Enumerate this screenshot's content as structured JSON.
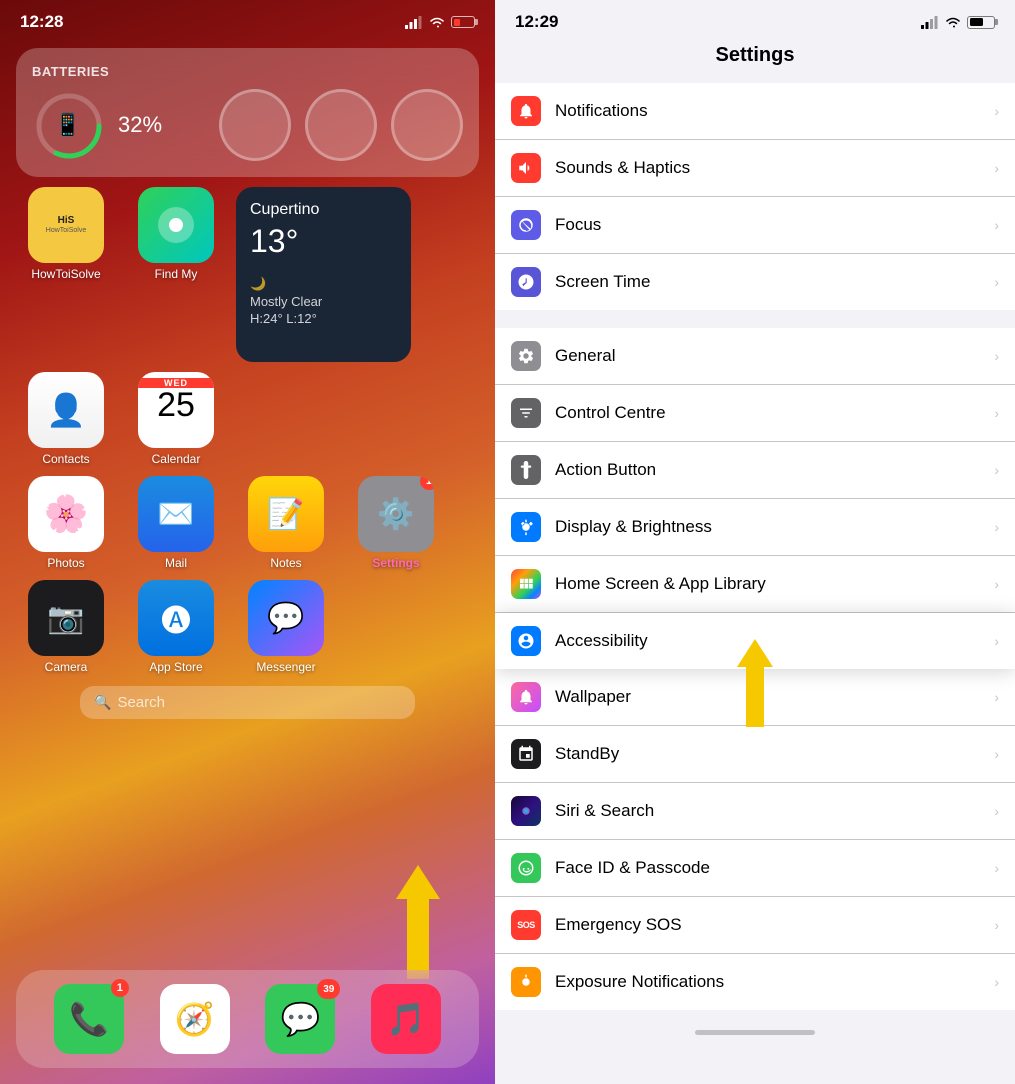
{
  "left": {
    "time": "12:28",
    "battery_percent": "32%",
    "widgets": {
      "battery_title": "Batteries",
      "weather_city": "Cupertino",
      "weather_temp": "13°",
      "weather_desc": "Mostly Clear",
      "weather_range": "H:24° L:12°",
      "weather_day": "WED",
      "weather_date": "25"
    },
    "apps": [
      {
        "label": "HowToiSolve",
        "bg": "howtoisolve",
        "emoji": "📰"
      },
      {
        "label": "Find My",
        "bg": "findmy",
        "emoji": "🔍"
      },
      {
        "label": "Contacts",
        "bg": "contacts",
        "emoji": "👤"
      },
      {
        "label": "Calendar",
        "bg": "calendar",
        "emoji": "📅"
      },
      {
        "label": "Photos",
        "bg": "photos",
        "emoji": "🌸"
      },
      {
        "label": "Mail",
        "bg": "mail",
        "emoji": "✉️"
      },
      {
        "label": "Notes",
        "bg": "notes",
        "emoji": "📝"
      },
      {
        "label": "Settings",
        "bg": "settings",
        "emoji": "⚙️",
        "badge": "1"
      },
      {
        "label": "Camera",
        "bg": "camera",
        "emoji": "📷"
      },
      {
        "label": "App Store",
        "bg": "appstore",
        "emoji": "🅐"
      },
      {
        "label": "Messenger",
        "bg": "messenger",
        "emoji": "💬"
      }
    ],
    "search_placeholder": "Search",
    "dock": [
      {
        "label": "Phone",
        "bg": "#34c759",
        "emoji": "📞",
        "badge": "1"
      },
      {
        "label": "Safari",
        "bg": "#fff",
        "emoji": "🧭",
        "badge": ""
      },
      {
        "label": "Messages",
        "bg": "#34c759",
        "emoji": "💬",
        "badge": "39"
      },
      {
        "label": "Music",
        "bg": "#ff2d55",
        "emoji": "🎵",
        "badge": ""
      }
    ]
  },
  "right": {
    "time": "12:29",
    "title": "Settings",
    "sections": [
      {
        "items": [
          {
            "label": "Notifications",
            "icon_color": "icon-red",
            "icon_symbol": "🔔"
          },
          {
            "label": "Sounds & Haptics",
            "icon_color": "icon-red",
            "icon_symbol": "🔊"
          },
          {
            "label": "Focus",
            "icon_color": "icon-purple",
            "icon_symbol": "🌙"
          },
          {
            "label": "Screen Time",
            "icon_color": "icon-purple2",
            "icon_symbol": "⏱"
          }
        ]
      },
      {
        "items": [
          {
            "label": "General",
            "icon_color": "icon-gray",
            "icon_symbol": "⚙️"
          },
          {
            "label": "Control Centre",
            "icon_color": "icon-gray2",
            "icon_symbol": "🎛"
          },
          {
            "label": "Action Button",
            "icon_color": "icon-gray2",
            "icon_symbol": "↩"
          },
          {
            "label": "Display & Brightness",
            "icon_color": "icon-blue",
            "icon_symbol": "☀️"
          },
          {
            "label": "Home Screen & App Library",
            "icon_color": "icon-multicolor",
            "icon_symbol": "⊞"
          },
          {
            "label": "Accessibility",
            "icon_color": "icon-blue",
            "icon_symbol": "♿",
            "highlighted": true
          },
          {
            "label": "Wallpaper",
            "icon_color": "icon-multicolor",
            "icon_symbol": "🌺"
          },
          {
            "label": "StandBy",
            "icon_color": "icon-black",
            "icon_symbol": "⊟"
          },
          {
            "label": "Siri & Search",
            "icon_color": "icon-siri",
            "icon_symbol": "◉"
          },
          {
            "label": "Face ID & Passcode",
            "icon_color": "icon-green",
            "icon_symbol": "👤"
          },
          {
            "label": "Emergency SOS",
            "icon_color": "icon-sos",
            "icon_symbol": "SOS"
          },
          {
            "label": "Exposure Notifications",
            "icon_color": "icon-exposure",
            "icon_symbol": "☀"
          }
        ]
      }
    ]
  }
}
